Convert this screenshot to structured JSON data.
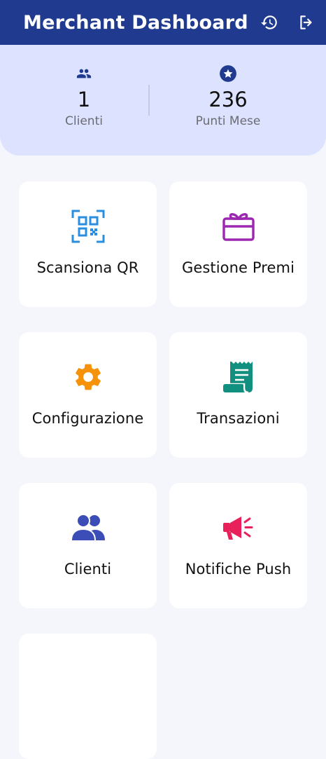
{
  "appbar": {
    "title": "Merchant Dashboard",
    "history_icon": "history-icon",
    "logout_icon": "logout-icon"
  },
  "stats": {
    "clients": {
      "icon": "people-icon",
      "value": "1",
      "label": "Clienti"
    },
    "points": {
      "icon": "star-icon",
      "value": "236",
      "label": "Punti Mese"
    }
  },
  "menu": [
    {
      "label": "Scansiona QR",
      "icon": "qr-scan-icon",
      "color": "#2a8fe0"
    },
    {
      "label": "Gestione Premi",
      "icon": "gift-card-icon",
      "color": "#9c27b0"
    },
    {
      "label": "Configurazione",
      "icon": "gear-icon",
      "color": "#f5920a"
    },
    {
      "label": "Transazioni",
      "icon": "receipt-icon",
      "color": "#12907f"
    },
    {
      "label": "Clienti",
      "icon": "people-icon",
      "color": "#3d4db8"
    },
    {
      "label": "Notifiche Push",
      "icon": "megaphone-icon",
      "color": "#e8215a"
    }
  ],
  "colors": {
    "appbar": "#1f3a8f",
    "stats_bg": "#dde3ff",
    "page_bg": "#f5f6fb"
  }
}
